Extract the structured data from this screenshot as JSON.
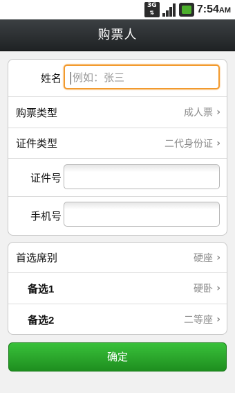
{
  "status_bar": {
    "network": "3G",
    "time": "7:54",
    "ampm": "AM",
    "icons": [
      "3g-data-icon",
      "signal-icon",
      "battery-icon"
    ]
  },
  "header": {
    "title": "购票人"
  },
  "passenger_form": {
    "name_label": "姓名",
    "name_placeholder": "例如：张三",
    "ticket_type_label": "购票类型",
    "ticket_type_value": "成人票",
    "id_type_label": "证件类型",
    "id_type_value": "二代身份证",
    "id_number_label": "证件号",
    "id_number_value": "",
    "phone_label": "手机号",
    "phone_value": ""
  },
  "seat_prefs": {
    "first_label": "首选席别",
    "first_value": "硬座",
    "alt1_label": "备选1",
    "alt1_value": "硬卧",
    "alt2_label": "备选2",
    "alt2_value": "二等座"
  },
  "chevron": "›",
  "confirm_label": "确定",
  "colors": {
    "accent_green": "#2aa52b",
    "focus_orange": "#f29a2e"
  }
}
